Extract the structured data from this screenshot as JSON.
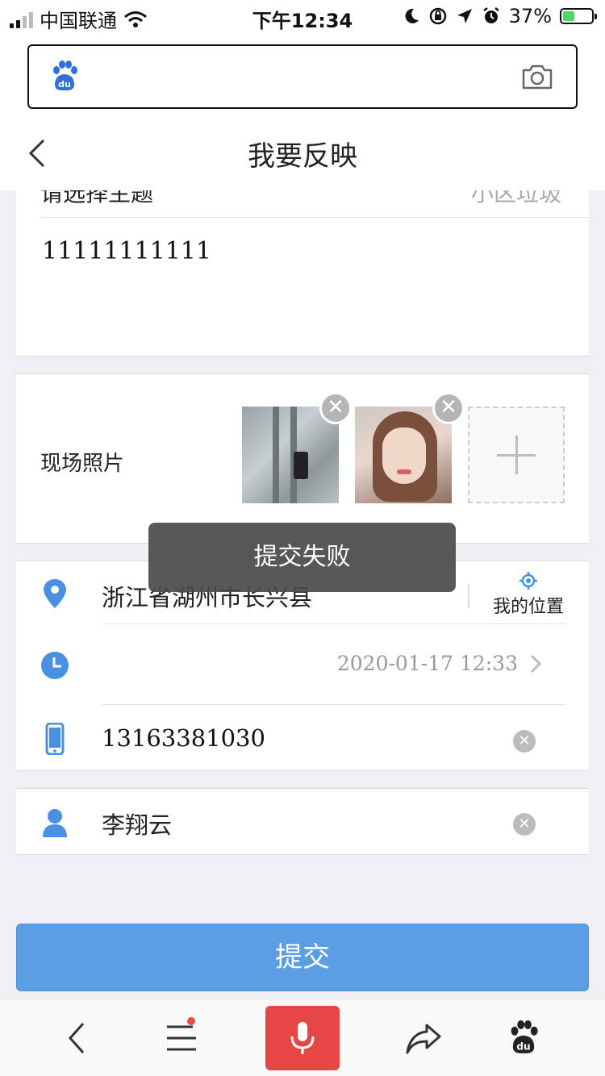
{
  "status_bar": {
    "carrier": "中国联通",
    "time": "下午12:34",
    "battery_percent": "37%"
  },
  "header": {
    "title": "我要反映"
  },
  "topic": {
    "label": "请选择主题",
    "value": "小区垃圾"
  },
  "content": {
    "text": "11111111111"
  },
  "photos": {
    "label": "现场照片",
    "count": 2,
    "remove_glyph": "✕",
    "add_glyph": "+"
  },
  "location": {
    "address": "浙江省湖州市长兴县",
    "my_location_label": "我的位置"
  },
  "time_row": {
    "datetime": "2020-01-17 12:33"
  },
  "phone_row": {
    "number": "13163381030",
    "clear_glyph": "✕"
  },
  "name_row": {
    "name": "李翔云",
    "clear_glyph": "✕"
  },
  "submit": {
    "label": "提交"
  },
  "toast": {
    "message": "提交失败"
  },
  "colors": {
    "accent": "#5b9ee4",
    "icon_blue": "#4a90e2",
    "voice_red": "#e84545",
    "background": "#efeff4"
  },
  "icons": {
    "search_logo": "baidu-paw-icon",
    "camera": "camera-icon",
    "back": "chevron-left-icon",
    "location": "map-pin-icon",
    "locate": "crosshair-icon",
    "clock": "clock-icon",
    "phone": "phone-icon",
    "user": "user-icon",
    "nav_back": "chevron-left-icon",
    "nav_menu": "menu-icon",
    "nav_voice": "microphone-icon",
    "nav_share": "share-icon",
    "nav_home": "baidu-paw-icon"
  }
}
